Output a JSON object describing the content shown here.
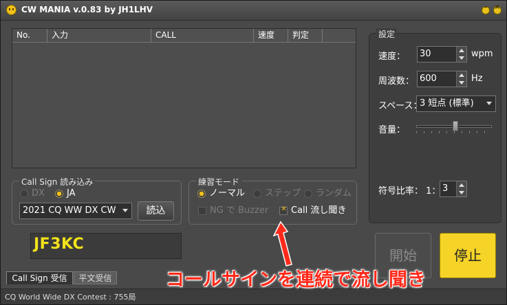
{
  "titlebar": {
    "title": "CW MANIA v.0.83 by JH1LHV",
    "minimize_glyph": "–",
    "close_glyph": "×"
  },
  "list": {
    "columns": [
      "No.",
      "入力",
      "CALL",
      "速度",
      "判定"
    ]
  },
  "callsign_load": {
    "title": "Call Sign 読み込み",
    "radio_dx": "DX",
    "radio_ja": "JA",
    "contest_selected": "2021 CQ WW DX CW",
    "load_button": "読込"
  },
  "practice_mode": {
    "title": "練習モード",
    "normal": "ノーマル",
    "step": "ステップ",
    "random": "ランダム",
    "ng_buzzer": "NG で Buzzer",
    "call_stream": "Call 流し聞き"
  },
  "callsign_display": "JF3KC",
  "tabs": {
    "callsign_rx": "Call Sign 受信",
    "plain_rx": "平文受信"
  },
  "status": "CQ World Wide DX Contest : 755局",
  "settings": {
    "title": "設定",
    "speed_label": "速度：",
    "speed_value": "30",
    "speed_unit": "wpm",
    "freq_label": "周波数：",
    "freq_value": "600",
    "freq_unit": "Hz",
    "space_label": "スペース：",
    "space_value": "3 短点 (標準)",
    "volume_label": "音量：",
    "volume_level": 0.52,
    "ratio_label": "符号比率： 1：",
    "ratio_value": "3"
  },
  "buttons": {
    "start": "開始",
    "stop": "停止"
  },
  "annotation": "コールサインを連続で流し聞き",
  "colors": {
    "accent": "#f5d327",
    "call_text": "#f2e21b",
    "annotation": "#ff2a1a"
  }
}
